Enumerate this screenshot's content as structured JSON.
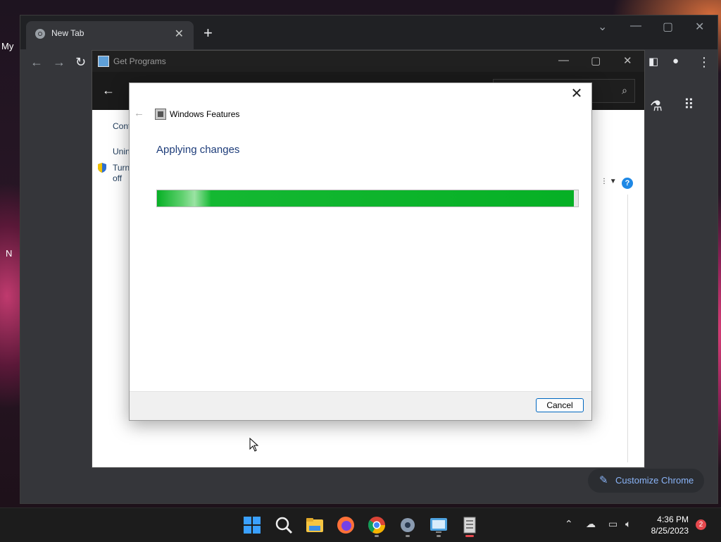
{
  "desktop": {
    "left_text_1": "My",
    "left_text_2": "N"
  },
  "chrome": {
    "tab_title": "New Tab",
    "customize_label": "Customize Chrome"
  },
  "control_panel": {
    "title": "Get Programs",
    "side_1": "Cont",
    "side_2": "Unin",
    "side_3": "Turn",
    "side_4": "off",
    "help_glyph": "?"
  },
  "dialog": {
    "title": "Windows Features",
    "heading": "Applying changes",
    "progress": 0.99,
    "cancel_label": "Cancel"
  },
  "taskbar": {
    "time": "4:36 PM",
    "date": "8/25/2023",
    "notification_count": "2"
  },
  "colors": {
    "progress_green": "#06b025",
    "heading_blue": "#1e3d7a",
    "chrome_link": "#8ab4f8"
  }
}
